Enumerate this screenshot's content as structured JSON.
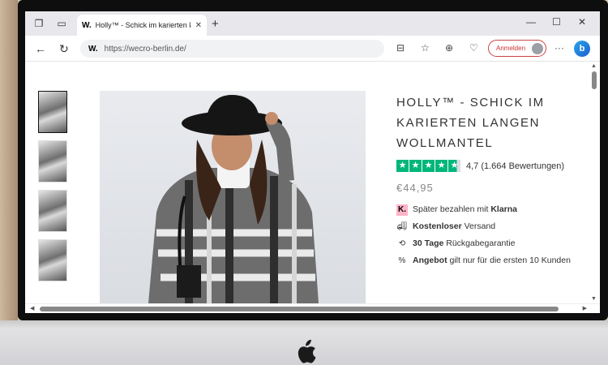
{
  "browser": {
    "tab_title": "Holly™ - Schick im karierten lang",
    "tab_favicon": "W.",
    "url": "https://wecro-berlin.de/",
    "site_icon": "W.",
    "signin_label": "Anmelden",
    "copilot_label": "b"
  },
  "product": {
    "title_line1": "HOLLY™ - SCHICK IM",
    "title_line2": "KARIERTEN LANGEN",
    "title_line3": "WOLLMANTEL",
    "rating_text": "4,7 (1.664 Bewertungen)",
    "rating_value": 4.7,
    "price": "€44,95",
    "features": [
      {
        "icon": "klarna-icon",
        "prefix": "Später bezahlen mit ",
        "bold": "Klarna",
        "suffix": ""
      },
      {
        "icon": "truck-icon",
        "prefix": "",
        "bold": "Kostenloser",
        "suffix": " Versand"
      },
      {
        "icon": "return-icon",
        "prefix": "",
        "bold": "30 Tage",
        "suffix": " Rückgabegarantie"
      },
      {
        "icon": "percent-icon",
        "prefix": "",
        "bold": "Angebot",
        "suffix": " gilt nur für die ersten 10 Kunden"
      }
    ]
  },
  "colors": {
    "trustpilot_green": "#00b67a",
    "klarna_pink": "#ffb3c7",
    "signin_red": "#cc3333"
  }
}
